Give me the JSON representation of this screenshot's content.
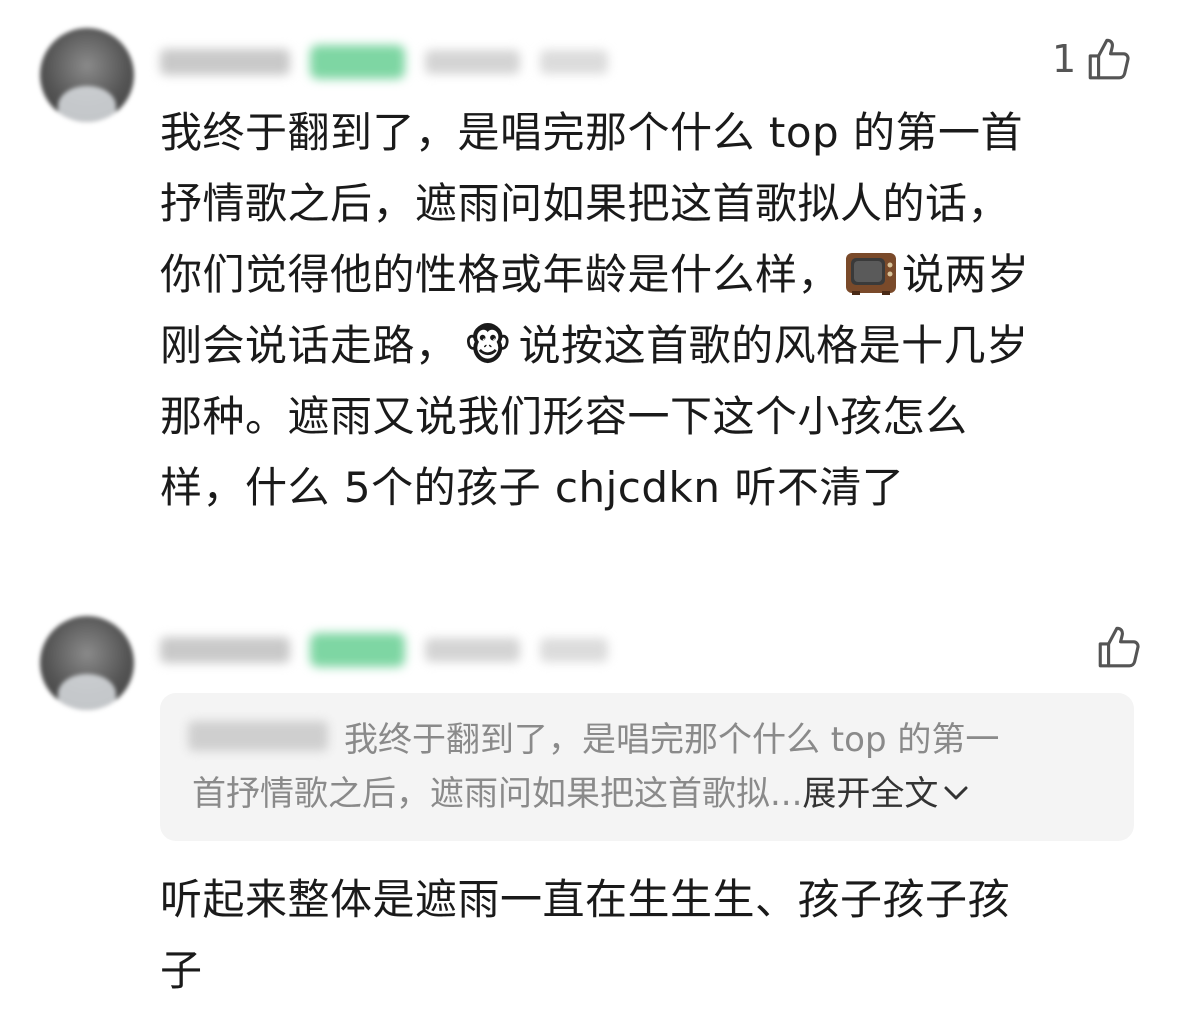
{
  "comments": [
    {
      "like_count": "1",
      "lines": [
        "我终于翻到了，是唱完那个什么 top 的第一首",
        "抒情歌之后，遮雨问如果把这首歌拟人的话，",
        "你们觉得他的性格或年龄是什么样，",
        "说两岁",
        "刚会说话走路，",
        "说按这首歌的风格是十几岁",
        "那种。遮雨又说我们形容一下这个小孩怎么",
        "样，什么 5个的孩子 chjcdkn 听不清了"
      ],
      "emoji_tv": "television-emoji",
      "emoji_monkey": "🐵"
    },
    {
      "like_count": "",
      "quote": {
        "line1": "我终于翻到了，是唱完那个什么 top 的第一",
        "line2": "首抒情歌之后，遮雨问如果把这首歌拟...",
        "expand_label": "展开全文"
      },
      "lines": [
        "听起来整体是遮雨一直在生生生、孩子孩子孩",
        "子"
      ]
    }
  ],
  "colors": {
    "badge_green": "#7ed6a3",
    "quote_bg": "#f4f4f4",
    "muted_text": "#8a8a8a"
  },
  "icons": {
    "like": "thumbs-up-icon",
    "expand": "chevron-down-icon"
  }
}
